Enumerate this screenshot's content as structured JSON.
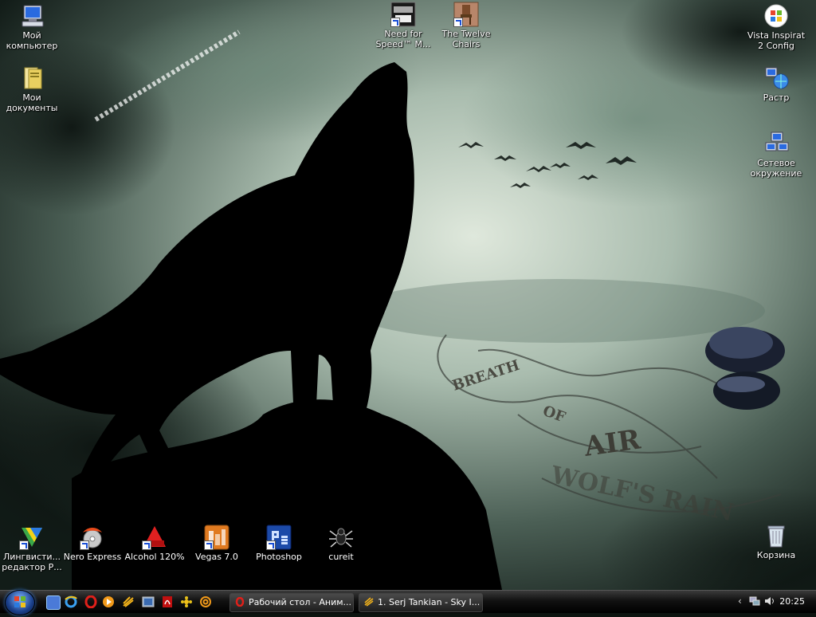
{
  "desktop": {
    "left_icons": [
      {
        "label": "Мой компьютер",
        "icon": "computer-icon"
      },
      {
        "label": "Мои документы",
        "icon": "documents-folder-icon"
      }
    ],
    "top_icons": [
      {
        "label": "Need for Speed™ M...",
        "icon": "nfs-game-icon"
      },
      {
        "label": "The Twelve Chairs",
        "icon": "chair-icon"
      }
    ],
    "right_icons": [
      {
        "label": "Vista Inspirat 2 Config",
        "icon": "windows-logo-icon"
      },
      {
        "label": "Растр",
        "icon": "network-globe-icon"
      },
      {
        "label": "Сетевое окружение",
        "icon": "network-places-icon"
      },
      {
        "label": "Корзина",
        "icon": "recycle-bin-icon"
      }
    ],
    "bottom_icons": [
      {
        "label": "Лингвисти... редактор Р...",
        "icon": "lingvo-icon"
      },
      {
        "label": "Nero Express",
        "icon": "nero-icon"
      },
      {
        "label": "Alcohol 120%",
        "icon": "alcohol-icon"
      },
      {
        "label": "Vegas 7.0",
        "icon": "vegas-icon"
      },
      {
        "label": "Photoshop",
        "icon": "photoshop-icon"
      },
      {
        "label": "cureit",
        "icon": "spider-icon"
      }
    ],
    "wallpaper_text": [
      "BREATH",
      "OF",
      "AIR",
      "WOLF'S RAIN"
    ]
  },
  "taskbar": {
    "quick_launch": [
      "show-desktop-icon",
      "ie-icon",
      "opera-icon",
      "media-player-icon",
      "winamp-icon",
      "explorer-icon",
      "acrobat-icon",
      "icq-icon",
      "mail-icon"
    ],
    "tasks": [
      {
        "label": "Рабочий стол - Аним...",
        "icon": "opera-icon"
      },
      {
        "label": "1. Serj Tankian - Sky I...",
        "icon": "winamp-icon"
      }
    ],
    "clock": "20:25"
  },
  "colors": {
    "accent": "#1a4fd6",
    "taskbar": "#111111",
    "sky": "#a9bcae"
  }
}
